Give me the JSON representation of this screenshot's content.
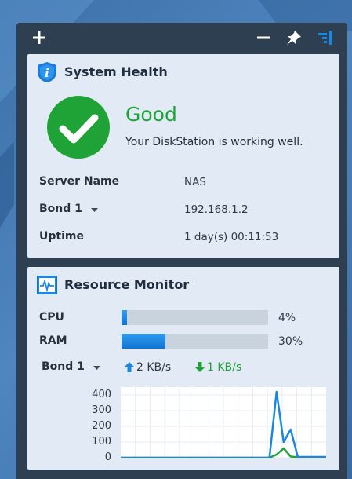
{
  "colors": {
    "good_green": "#1fa336",
    "accent_blue": "#1a87e0",
    "upload_blue": "#1a87e0",
    "download_green": "#1fa336"
  },
  "toolbar": {
    "add_icon": "plus-icon",
    "minimize_icon": "minus-icon",
    "pin_icon": "pin-icon",
    "panel_icon": "sidebar-toggle-icon"
  },
  "system_health": {
    "title": "System Health",
    "status": "Good",
    "message": "Your DiskStation is working well.",
    "rows": [
      {
        "label": "Server Name",
        "value": "NAS"
      },
      {
        "label": "Bond 1",
        "value": "192.168.1.2"
      },
      {
        "label": "Uptime",
        "value": "1 day(s) 00:11:53"
      }
    ]
  },
  "resource_monitor": {
    "title": "Resource Monitor",
    "cpu": {
      "label": "CPU",
      "percent": 4,
      "text": "4%"
    },
    "ram": {
      "label": "RAM",
      "percent": 30,
      "text": "30%"
    },
    "network": {
      "label": "Bond 1",
      "upload": "2 KB/s",
      "download": "1 KB/s"
    }
  },
  "chart_data": {
    "type": "line",
    "title": "",
    "xlabel": "",
    "ylabel": "",
    "ylim": [
      0,
      450
    ],
    "yticks": [
      "400",
      "300",
      "200",
      "100",
      "0"
    ],
    "x": [
      0,
      1,
      2,
      3,
      4,
      5,
      6,
      7,
      8,
      9,
      10,
      11,
      12,
      13,
      14,
      15,
      16,
      17,
      18,
      19,
      20,
      21,
      22,
      23,
      24,
      25,
      26,
      27,
      28,
      29
    ],
    "series": [
      {
        "color": "#1a87e0",
        "values": [
          0,
          0,
          0,
          0,
          0,
          0,
          0,
          0,
          0,
          0,
          0,
          0,
          0,
          0,
          0,
          0,
          0,
          0,
          0,
          0,
          0,
          0,
          420,
          100,
          180,
          5,
          5,
          5,
          5,
          5
        ]
      },
      {
        "color": "#1fa336",
        "values": [
          0,
          0,
          0,
          0,
          0,
          0,
          0,
          0,
          0,
          0,
          0,
          0,
          0,
          0,
          0,
          0,
          0,
          0,
          0,
          0,
          0,
          0,
          20,
          60,
          8,
          2,
          2,
          2,
          2,
          2
        ]
      }
    ]
  }
}
